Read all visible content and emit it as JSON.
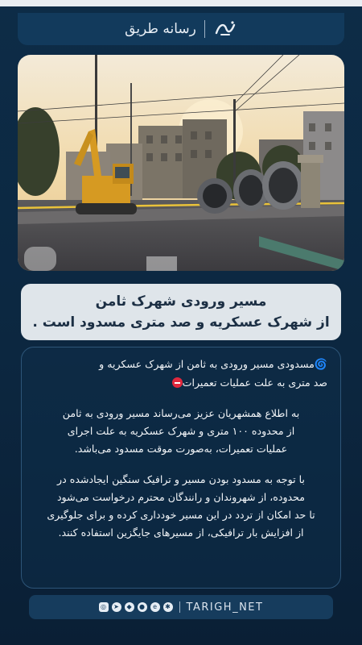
{
  "header": {
    "brand_text": "رسانه طریق",
    "logo_icon": "tarigh-logo-icon"
  },
  "photo": {
    "alt_desc_icon": "construction-photo",
    "watermark_icon": "watermark-logo-icon"
  },
  "title": {
    "line1": "مسیر ورودی شهرک ثامن",
    "line2": "از شهرک عسکریه و صد متری مسدود است ."
  },
  "body": {
    "lead_line1": "مسدودی مسیر ورودی به ثامن از شهرک عسکریه و",
    "lead_line2": "صد متری به علت عملیات تعمیرات",
    "lead_icon": "cyclone-icon",
    "lead_end_icon": "no-entry-icon",
    "para2_line1": "به اطلاع همشهریان عزیز می‌رساند مسیر ورودی به ثامن",
    "para2_line2": "از محدوده ۱۰۰ متری و شهرک عسکریه به علت اجرای",
    "para2_line3": "عملیات تعمیرات، به‌صورت موقت مسدود می‌باشد.",
    "para3_line1": "با توجه به مسدود بودن مسیر و ترافیک سنگین ایجادشده در",
    "para3_line2": "محدوده، از شهروندان و رانندگان محترم درخواست می‌شود",
    "para3_line3": "تا حد امکان از تردد در این مسیر خودداری کرده و برای جلوگیری",
    "para3_line4": "از افزایش بار ترافیکی، از مسیرهای جایگزین استفاده کنند."
  },
  "footer": {
    "handle": "TARIGH_NET",
    "icons": [
      "aparat-icon",
      "eitaa-icon",
      "bale-icon",
      "rubika-icon",
      "telegram-icon",
      "instagram-icon"
    ]
  },
  "colors": {
    "background": "#0d2a44",
    "title_bg": "#dfe5ea",
    "accent_red": "#e0283d"
  }
}
